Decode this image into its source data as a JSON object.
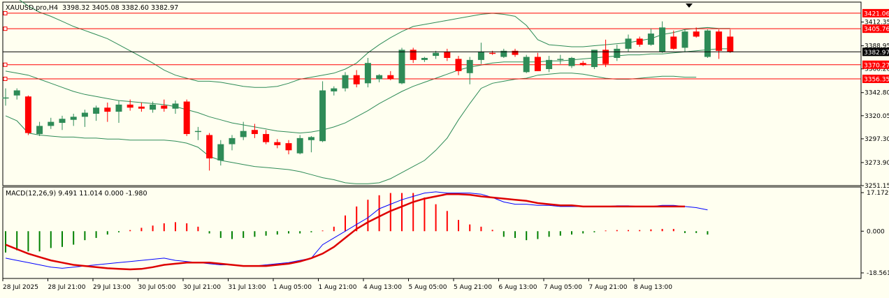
{
  "header": {
    "symbol_line": "XAUUSD.pro,H4",
    "ohlc_line": "3398.32 3405.08 3382.60 3382.97"
  },
  "macd_header": {
    "label": "MACD(12,26,9)",
    "values": "9.491 11.014 0.000 -1.980"
  },
  "colors": {
    "background": "#fffff0",
    "bull": "#2e8b57",
    "bear": "#ff0000",
    "band": "#2e8b57",
    "level_line": "#ff0000",
    "price_line": "#000000",
    "histogram_up": "#ff0000",
    "histogram_down": "#008000",
    "macd_line": "#0000ff",
    "signal_line": "#dd0000",
    "border": "#000000"
  },
  "chart_data": {
    "type": "candlestick",
    "x_tick_labels": [
      "28 Jul 2025",
      "28 Jul 21:00",
      "29 Jul 13:00",
      "30 Jul 05:00",
      "30 Jul 21:00",
      "31 Jul 13:00",
      "1 Aug 05:00",
      "1 Aug 21:00",
      "4 Aug 13:00",
      "5 Aug 05:00",
      "5 Aug 21:00",
      "6 Aug 13:00",
      "7 Aug 05:00",
      "7 Aug 21:00",
      "8 Aug 13:00"
    ],
    "y_tick_labels": [
      3412.35,
      3388.95,
      3366.2,
      3342.8,
      3320.05,
      3297.3,
      3273.9,
      3251.15
    ],
    "ylim": [
      3251.15,
      3432.0
    ],
    "level_lines": [
      {
        "value": 3421.06,
        "label": "3421.06"
      },
      {
        "value": 3405.76,
        "label": "3405.76"
      },
      {
        "value": 3370.27,
        "label": "3370.27"
      },
      {
        "value": 3356.35,
        "label": "3356.35"
      }
    ],
    "current_price": {
      "value": 3382.97,
      "label": "3382.97"
    },
    "candles": [
      {
        "o": 3337,
        "h": 3347,
        "l": 3330,
        "c": 3338
      },
      {
        "o": 3340,
        "h": 3347,
        "l": 3336,
        "c": 3345
      },
      {
        "o": 3339,
        "h": 3340,
        "l": 3301,
        "c": 3303
      },
      {
        "o": 3302,
        "h": 3314,
        "l": 3300,
        "c": 3310
      },
      {
        "o": 3310,
        "h": 3318,
        "l": 3307,
        "c": 3314
      },
      {
        "o": 3313,
        "h": 3320,
        "l": 3306,
        "c": 3317
      },
      {
        "o": 3316,
        "h": 3322,
        "l": 3310,
        "c": 3319
      },
      {
        "o": 3319,
        "h": 3326,
        "l": 3309,
        "c": 3323
      },
      {
        "o": 3322,
        "h": 3330,
        "l": 3315,
        "c": 3328
      },
      {
        "o": 3328,
        "h": 3333,
        "l": 3314,
        "c": 3324
      },
      {
        "o": 3324,
        "h": 3335,
        "l": 3313,
        "c": 3331
      },
      {
        "o": 3331,
        "h": 3336,
        "l": 3325,
        "c": 3328
      },
      {
        "o": 3329,
        "h": 3333,
        "l": 3324,
        "c": 3327
      },
      {
        "o": 3326,
        "h": 3334,
        "l": 3323,
        "c": 3331
      },
      {
        "o": 3330,
        "h": 3336,
        "l": 3324,
        "c": 3327
      },
      {
        "o": 3327,
        "h": 3335,
        "l": 3322,
        "c": 3332
      },
      {
        "o": 3334,
        "h": 3336,
        "l": 3300,
        "c": 3302
      },
      {
        "o": 3304,
        "h": 3309,
        "l": 3296,
        "c": 3305
      },
      {
        "o": 3301,
        "h": 3303,
        "l": 3266,
        "c": 3278
      },
      {
        "o": 3276,
        "h": 3296,
        "l": 3271,
        "c": 3292
      },
      {
        "o": 3292,
        "h": 3301,
        "l": 3286,
        "c": 3298
      },
      {
        "o": 3299,
        "h": 3314,
        "l": 3296,
        "c": 3305
      },
      {
        "o": 3306,
        "h": 3312,
        "l": 3298,
        "c": 3302
      },
      {
        "o": 3302,
        "h": 3306,
        "l": 3292,
        "c": 3294
      },
      {
        "o": 3294,
        "h": 3297,
        "l": 3288,
        "c": 3291
      },
      {
        "o": 3293,
        "h": 3296,
        "l": 3282,
        "c": 3286
      },
      {
        "o": 3283,
        "h": 3301,
        "l": 3282,
        "c": 3298
      },
      {
        "o": 3296,
        "h": 3300,
        "l": 3284,
        "c": 3299
      },
      {
        "o": 3295,
        "h": 3354,
        "l": 3294,
        "c": 3345
      },
      {
        "o": 3344,
        "h": 3349,
        "l": 3340,
        "c": 3347
      },
      {
        "o": 3347,
        "h": 3363,
        "l": 3344,
        "c": 3360
      },
      {
        "o": 3360,
        "h": 3365,
        "l": 3348,
        "c": 3351
      },
      {
        "o": 3352,
        "h": 3377,
        "l": 3348,
        "c": 3372
      },
      {
        "o": 3356,
        "h": 3361,
        "l": 3353,
        "c": 3360
      },
      {
        "o": 3360,
        "h": 3364,
        "l": 3355,
        "c": 3356
      },
      {
        "o": 3352,
        "h": 3387,
        "l": 3351,
        "c": 3385
      },
      {
        "o": 3385,
        "h": 3387,
        "l": 3372,
        "c": 3375
      },
      {
        "o": 3375,
        "h": 3378,
        "l": 3373,
        "c": 3377
      },
      {
        "o": 3379,
        "h": 3384,
        "l": 3376,
        "c": 3382
      },
      {
        "o": 3383,
        "h": 3386,
        "l": 3374,
        "c": 3377
      },
      {
        "o": 3376,
        "h": 3379,
        "l": 3360,
        "c": 3364
      },
      {
        "o": 3362,
        "h": 3378,
        "l": 3351,
        "c": 3375
      },
      {
        "o": 3375,
        "h": 3392,
        "l": 3371,
        "c": 3383
      },
      {
        "o": 3382,
        "h": 3384,
        "l": 3380,
        "c": 3381
      },
      {
        "o": 3378,
        "h": 3386,
        "l": 3377,
        "c": 3384
      },
      {
        "o": 3384,
        "h": 3386,
        "l": 3378,
        "c": 3380
      },
      {
        "o": 3363,
        "h": 3380,
        "l": 3362,
        "c": 3378
      },
      {
        "o": 3378,
        "h": 3382,
        "l": 3364,
        "c": 3364
      },
      {
        "o": 3366,
        "h": 3379,
        "l": 3363,
        "c": 3375
      },
      {
        "o": 3375,
        "h": 3380,
        "l": 3371,
        "c": 3376
      },
      {
        "o": 3369,
        "h": 3378,
        "l": 3367,
        "c": 3377
      },
      {
        "o": 3372,
        "h": 3374,
        "l": 3369,
        "c": 3370
      },
      {
        "o": 3368,
        "h": 3383,
        "l": 3366,
        "c": 3385
      },
      {
        "o": 3385,
        "h": 3395,
        "l": 3368,
        "c": 3371
      },
      {
        "o": 3377,
        "h": 3390,
        "l": 3374,
        "c": 3386
      },
      {
        "o": 3386,
        "h": 3400,
        "l": 3383,
        "c": 3396
      },
      {
        "o": 3396,
        "h": 3398,
        "l": 3388,
        "c": 3390
      },
      {
        "o": 3390,
        "h": 3406,
        "l": 3389,
        "c": 3401
      },
      {
        "o": 3383,
        "h": 3413,
        "l": 3382,
        "c": 3407
      },
      {
        "o": 3398,
        "h": 3404,
        "l": 3385,
        "c": 3386
      },
      {
        "o": 3387,
        "h": 3405,
        "l": 3383,
        "c": 3403
      },
      {
        "o": 3403,
        "h": 3407,
        "l": 3397,
        "c": 3398
      },
      {
        "o": 3378,
        "h": 3405,
        "l": 3377,
        "c": 3404
      },
      {
        "o": 3403,
        "h": 3405,
        "l": 3376,
        "c": 3384
      },
      {
        "o": 3398,
        "h": 3405,
        "l": 3382,
        "c": 3383
      }
    ],
    "bands": {
      "upper": [
        3440,
        3436,
        3428,
        3422,
        3418,
        3413,
        3408,
        3404,
        3400,
        3396,
        3390,
        3384,
        3378,
        3372,
        3365,
        3360,
        3357,
        3354,
        3354,
        3353,
        3351,
        3349,
        3348,
        3348,
        3349,
        3352,
        3356,
        3358,
        3360,
        3362,
        3366,
        3372,
        3382,
        3390,
        3397,
        3403,
        3408,
        3410,
        3412,
        3414,
        3416,
        3418,
        3420,
        3421,
        3420,
        3418,
        3409,
        3395,
        3390,
        3389,
        3388,
        3388,
        3389,
        3390,
        3391,
        3392,
        3394,
        3396,
        3400,
        3402,
        3405,
        3406,
        3407,
        3406,
        3406
      ],
      "middle": [
        3364,
        3362,
        3360,
        3356,
        3352,
        3348,
        3344,
        3341,
        3339,
        3337,
        3335,
        3334,
        3333,
        3332,
        3331,
        3329,
        3326,
        3323,
        3319,
        3316,
        3313,
        3311,
        3309,
        3307,
        3305,
        3304,
        3303,
        3304,
        3306,
        3309,
        3313,
        3319,
        3325,
        3332,
        3338,
        3344,
        3349,
        3353,
        3357,
        3361,
        3365,
        3368,
        3370,
        3372,
        3373,
        3373,
        3373,
        3373,
        3374,
        3374,
        3375,
        3376,
        3377,
        3378,
        3379,
        3380,
        3380,
        3381,
        3381,
        3382,
        3383,
        3384,
        3385,
        3386,
        3386
      ],
      "lower": [
        3320,
        3315,
        3303,
        3301,
        3300,
        3299,
        3299,
        3298,
        3298,
        3297,
        3297,
        3296,
        3296,
        3296,
        3296,
        3295,
        3293,
        3289,
        3280,
        3276,
        3274,
        3272,
        3270,
        3269,
        3268,
        3267,
        3265,
        3262,
        3259,
        3257,
        3254,
        3253,
        3253,
        3254,
        3258,
        3264,
        3270,
        3276,
        3286,
        3298,
        3316,
        3332,
        3347,
        3352,
        3354,
        3356,
        3357,
        3360,
        3361,
        3362,
        3362,
        3361,
        3359,
        3357,
        3356,
        3356,
        3357,
        3358,
        3359,
        3359,
        3358,
        3358
      ]
    },
    "macd": {
      "label": "MACD(12,26,9)",
      "y_tick_labels": [
        17.172,
        0.0,
        -18.561
      ],
      "ylim": [
        -18.561,
        17.172
      ],
      "histogram": [
        -9.5,
        -8.5,
        -9,
        -9,
        -7.5,
        -7,
        -6,
        -4,
        -3,
        -1.5,
        -0.5,
        0.5,
        1.5,
        2.5,
        3.5,
        4,
        3.5,
        2,
        -1,
        -3,
        -3.5,
        -3,
        -2.5,
        -2,
        -1.5,
        -1,
        -1,
        -0.5,
        0.3,
        2,
        7,
        11,
        14,
        16,
        17,
        17,
        17,
        15,
        12,
        9,
        5,
        3,
        2,
        0.6,
        -2.5,
        -3,
        -4,
        -3.5,
        -2.5,
        -2,
        -1.5,
        -1,
        -0.5,
        0.3,
        0.5,
        0.5,
        0.5,
        0.8,
        1,
        1,
        -0.8,
        -0.8,
        -1.5
      ],
      "macd_line": [
        -12,
        -13,
        -14,
        -15,
        -16,
        -16.5,
        -16,
        -15.5,
        -15,
        -14.5,
        -14,
        -13.5,
        -13,
        -12.5,
        -12,
        -13,
        -13.5,
        -14,
        -14.5,
        -15,
        -15,
        -15.5,
        -15.5,
        -15,
        -14.5,
        -14,
        -13,
        -12,
        -6,
        -3,
        0,
        3,
        6,
        10,
        12,
        14,
        15.5,
        17,
        17.5,
        17,
        17,
        17,
        16.5,
        15,
        13,
        12,
        12,
        11.5,
        11.5,
        11,
        11,
        11,
        11,
        11,
        11.3,
        11.3,
        11,
        11,
        11.5,
        11.5,
        11,
        10.5,
        9.5
      ],
      "signal_line": [
        -6,
        -8,
        -10,
        -11.5,
        -13,
        -14,
        -15,
        -15.5,
        -16,
        -16.5,
        -16.8,
        -17,
        -16.8,
        -16,
        -15,
        -14.5,
        -14,
        -14,
        -14,
        -14.5,
        -15,
        -15.5,
        -15.5,
        -15.5,
        -15,
        -14.5,
        -13.5,
        -12,
        -10,
        -7,
        -3,
        1,
        4,
        6.5,
        9,
        11,
        13,
        14.5,
        15.5,
        16.5,
        16.5,
        16.2,
        15.5,
        15,
        14.5,
        14,
        13.5,
        12.5,
        12,
        11.5,
        11.5,
        11,
        11,
        11,
        11,
        11,
        11,
        11,
        11,
        11,
        11
      ]
    }
  }
}
